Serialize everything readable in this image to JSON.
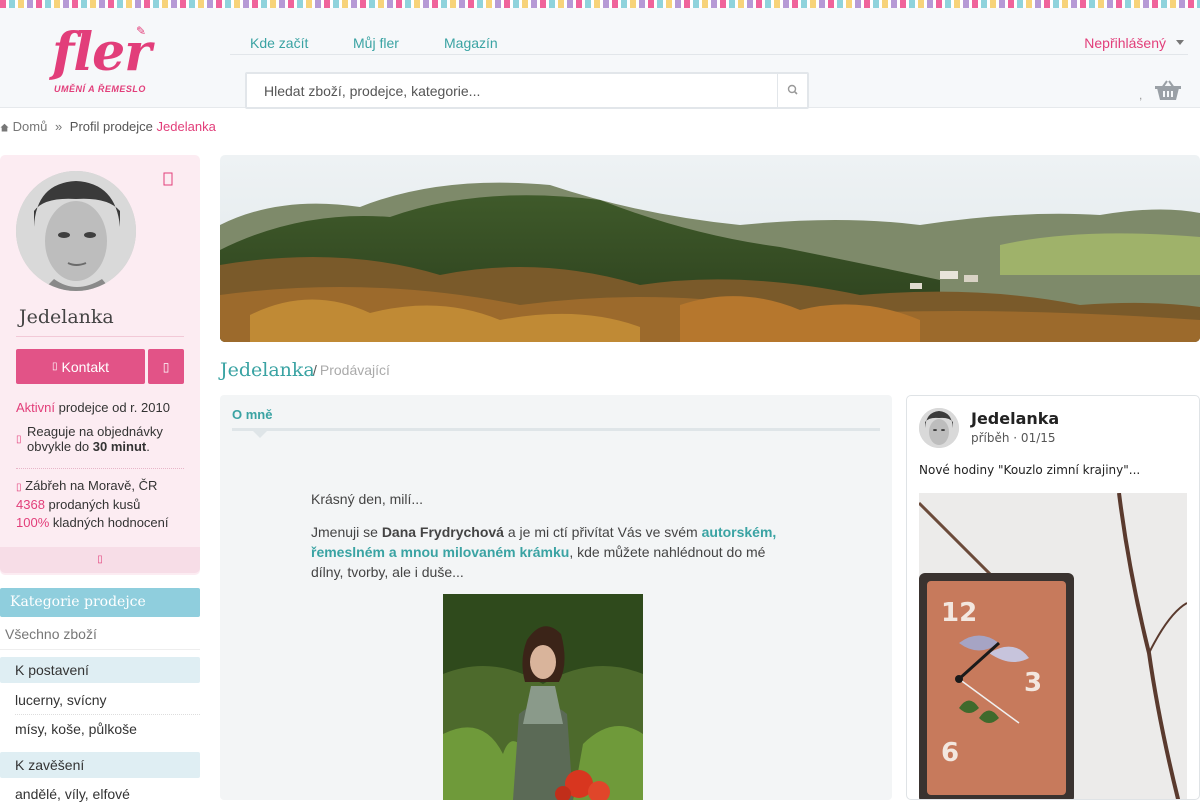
{
  "header": {
    "logo_word": "fler",
    "logo_sub": "UMĚNÍ A ŘEMESLO",
    "nav": [
      "Kde začít",
      "Můj fler",
      "Magazín"
    ],
    "login": "Nepřihlášený",
    "search_placeholder": "Hledat zboží, prodejce, kategorie...",
    "cart_count": ","
  },
  "breadcrumb": {
    "home": "Domů",
    "separator": "»",
    "current_prefix": "Profil prodejce",
    "current_name": "Jedelanka"
  },
  "sidebar": {
    "name": "Jedelanka",
    "contact": "Kontakt",
    "status_active": "Aktivní",
    "status_rest": " prodejce od r. 2010",
    "respond_text": "Reaguje na objednávky obvykle do",
    "respond_time": "30 minut",
    "location": "Zábřeh na Moravě, ČR",
    "sold_count": "4368",
    "sold_label": " prodaných kusů",
    "rating_pct": "100%",
    "rating_label": " kladných hodnocení"
  },
  "categories": {
    "title": "Kategorie prodejce",
    "all": "Všechno zboží",
    "groups": [
      {
        "name": "K postavení",
        "items": [
          "lucerny, svícny",
          "mísy, koše, půlkoše"
        ]
      },
      {
        "name": "K zavěšení",
        "items": [
          "andělé, víly, elfové"
        ]
      }
    ]
  },
  "profile": {
    "name": "Jedelanka",
    "role": "Prodávající"
  },
  "about": {
    "heading": "O mně",
    "greeting": "Krásný den, milí...",
    "intro_1": "Jmenuji se ",
    "intro_name": "Dana Frydrychová",
    "intro_2": " a je mi ctí přivítat Vás ve svém ",
    "intro_link": "autorském, řemeslném a mnou milovaném krámku",
    "intro_3": ", kde můžete nahlédnout do mé dílny, tvorby, ale i duše..."
  },
  "story": {
    "name": "Jedelanka",
    "meta": "příběh · 01/15",
    "text": "Nové hodiny \"Kouzlo zimní krajiny\"..."
  },
  "colors": {
    "brand_pink": "#e23e7a",
    "teal": "#3aa3a3",
    "category_blue": "#8fcedd"
  },
  "icons": [
    "home-icon",
    "search-icon",
    "basket-icon",
    "heart-icon",
    "envelope-icon",
    "share-icon",
    "clock-icon",
    "map-pin-icon",
    "chevron-down-icon"
  ]
}
